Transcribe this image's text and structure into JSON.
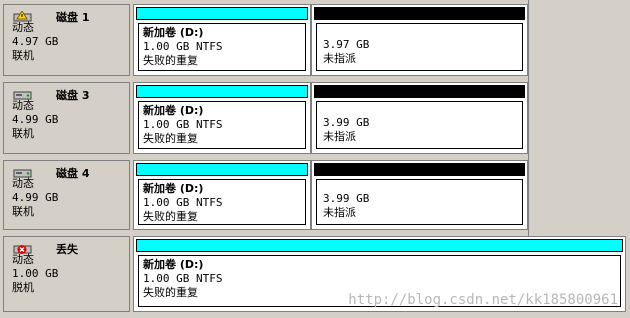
{
  "colors": {
    "primary": "#00ffff",
    "unallocated": "#000000"
  },
  "disks": [
    {
      "name": "磁盘 1",
      "type": "动态",
      "size": "4.97 GB",
      "status": "联机",
      "icon": "dynamic-disk-warning-icon",
      "volume": {
        "title": "新加卷  (D:)",
        "fs": "1.00 GB NTFS",
        "state": "失败的重复"
      },
      "unallocated": {
        "size": "3.97 GB",
        "label": "未指派"
      }
    },
    {
      "name": "磁盘 3",
      "type": "动态",
      "size": "4.99 GB",
      "status": "联机",
      "icon": "dynamic-disk-icon",
      "volume": {
        "title": "新加卷  (D:)",
        "fs": "1.00 GB NTFS",
        "state": "失败的重复"
      },
      "unallocated": {
        "size": "3.99 GB",
        "label": "未指派"
      }
    },
    {
      "name": "磁盘 4",
      "type": "动态",
      "size": "4.99 GB",
      "status": "联机",
      "icon": "dynamic-disk-icon",
      "volume": {
        "title": "新加卷  (D:)",
        "fs": "1.00 GB NTFS",
        "state": "失败的重复"
      },
      "unallocated": {
        "size": "3.99 GB",
        "label": "未指派"
      }
    },
    {
      "name": "丢失",
      "type": "动态",
      "size": "1.00 GB",
      "status": "脱机",
      "icon": "missing-disk-icon",
      "volume": {
        "title": "新加卷  (D:)",
        "fs": "1.00 GB NTFS",
        "state": "失败的重复"
      }
    }
  ],
  "watermark": "http://blog.csdn.net/kk185800961"
}
